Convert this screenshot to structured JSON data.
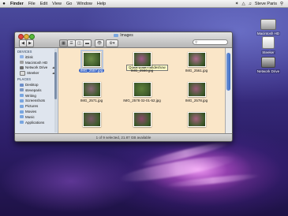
{
  "menubar": {
    "apple": "",
    "app": "Finder",
    "items": [
      "File",
      "Edit",
      "View",
      "Go",
      "Window",
      "Help"
    ],
    "user": "Steve Paris"
  },
  "desktop_icons": [
    {
      "label": "Macintosh HD",
      "icon": "hard-drive-icon"
    },
    {
      "label": "Steeker",
      "icon": "usb-drive-icon"
    },
    {
      "label": "Network Drive",
      "icon": "network-drive-icon"
    }
  ],
  "window": {
    "title": "Images",
    "tooltip": "Quick Look / Slideshow",
    "status": "1 of 9 selected, 21.87 GB available"
  },
  "sidebar": {
    "devices_header": "DEVICES",
    "devices": [
      "iDisk",
      "Macintosh HD",
      "Network Drive",
      "Steeker"
    ],
    "places_header": "PLACES",
    "places": [
      "Desktop",
      "steveparis",
      "Writing",
      "Screenshots",
      "Pictures",
      "Movies",
      "Music",
      "Applications"
    ]
  },
  "files": [
    {
      "name": "IMG_2557.jpg",
      "selected": true,
      "color": "#6f8e4a"
    },
    {
      "name": "IMG_2560.jpg",
      "selected": false,
      "color": "#a25a8c"
    },
    {
      "name": "IMG_2561.jpg",
      "selected": false,
      "color": "#b06a90"
    },
    {
      "name": "IMG_2571.jpg",
      "selected": false,
      "color": "#8a6a7a"
    },
    {
      "name": "IMG_2578 02-01-52.jpg",
      "selected": false,
      "color": "#5f7f3a"
    },
    {
      "name": "IMG_2578.jpg",
      "selected": false,
      "color": "#9a5a7a"
    },
    {
      "name": "",
      "selected": false,
      "color": "#7a5a6a"
    },
    {
      "name": "",
      "selected": false,
      "color": "#8a4a6a"
    },
    {
      "name": "",
      "selected": false,
      "color": "#a5607f"
    }
  ]
}
